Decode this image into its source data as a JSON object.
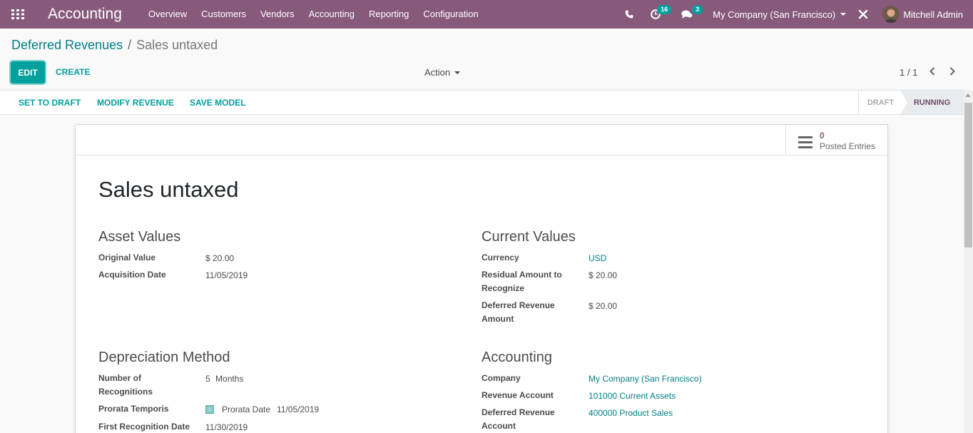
{
  "navbar": {
    "app_title": "Accounting",
    "menu": [
      "Overview",
      "Customers",
      "Vendors",
      "Accounting",
      "Reporting",
      "Configuration"
    ],
    "activity_count": "16",
    "message_count": "3",
    "company": "My Company (San Francisco)",
    "user": "Mitchell Admin",
    "color": "#875a7b"
  },
  "breadcrumb": {
    "parent": "Deferred Revenues",
    "separator": "/",
    "current": "Sales untaxed"
  },
  "control": {
    "edit": "EDIT",
    "create": "CREATE",
    "action": "Action",
    "pager": "1 / 1"
  },
  "statusbar": {
    "buttons": [
      "SET TO DRAFT",
      "MODIFY REVENUE",
      "SAVE MODEL"
    ],
    "stages": [
      "DRAFT",
      "RUNNING"
    ],
    "active_stage": "RUNNING"
  },
  "stat_button": {
    "value": "0",
    "label": "Posted Entries"
  },
  "form": {
    "title": "Sales untaxed",
    "asset_values": {
      "heading": "Asset Values",
      "original_value_label": "Original Value",
      "original_value": "$ 20.00",
      "acquisition_date_label": "Acquisition Date",
      "acquisition_date": "11/05/2019"
    },
    "current_values": {
      "heading": "Current Values",
      "currency_label": "Currency",
      "currency": "USD",
      "residual_label_1": "Residual Amount to",
      "residual_label_2": "Recognize",
      "residual": "$ 20.00",
      "deferred_label_1": "Deferred Revenue",
      "deferred_label_2": "Amount",
      "deferred": "$ 20.00"
    },
    "depreciation": {
      "heading": "Depreciation Method",
      "number_label_1": "Number of",
      "number_label_2": "Recognitions",
      "number_value": "5",
      "number_unit": "Months",
      "prorata_label": "Prorata Temporis",
      "prorata_checked": true,
      "prorata_date_label": "Prorata Date",
      "prorata_date": "11/05/2019",
      "first_recognition_label": "First Recognition Date",
      "first_recognition": "11/30/2019"
    },
    "accounting": {
      "heading": "Accounting",
      "company_label": "Company",
      "company": "My Company (San Francisco)",
      "revenue_account_label": "Revenue Account",
      "revenue_account": "101000 Current Assets",
      "deferred_account_label_1": "Deferred Revenue",
      "deferred_account_label_2": "Account",
      "deferred_account": "400000 Product Sales"
    }
  }
}
